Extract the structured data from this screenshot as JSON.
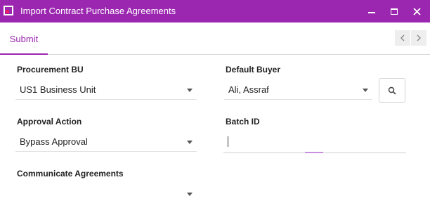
{
  "window": {
    "title": "Import Contract Purchase Agreements"
  },
  "tabs": [
    {
      "label": "Submit"
    }
  ],
  "form": {
    "procurement_bu": {
      "label": "Procurement BU",
      "value": "US1 Business Unit"
    },
    "default_buyer": {
      "label": "Default Buyer",
      "value": "Ali, Assraf"
    },
    "approval_action": {
      "label": "Approval Action",
      "value": "Bypass Approval"
    },
    "batch_id": {
      "label": "Batch ID",
      "value": ""
    },
    "communicate_agreements": {
      "label": "Communicate Agreements",
      "value": ""
    }
  },
  "colors": {
    "accent": "#9b27b0",
    "icon_square": "#e91e63"
  },
  "icons": [
    "app-icon",
    "minimize-icon",
    "maximize-icon",
    "close-icon",
    "chevron-left-icon",
    "chevron-right-icon",
    "search-icon",
    "chevron-down-icon"
  ]
}
